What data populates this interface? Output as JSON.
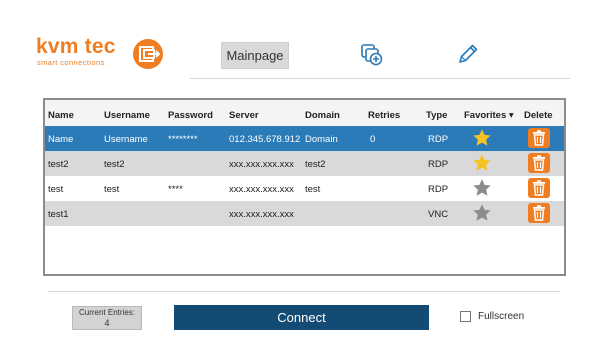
{
  "brand": {
    "name": "kvm tec",
    "tagline": "smart connections",
    "color": "#ef7d22"
  },
  "header": {
    "mainpage_label": "Mainpage",
    "icons": [
      "add-connection-icon",
      "edit-pencil-icon"
    ]
  },
  "table": {
    "columns": [
      "Name",
      "Username",
      "Password",
      "Server",
      "Domain",
      "Retries",
      "Type",
      "Favorites ▾",
      "Delete"
    ],
    "rows": [
      {
        "name": "Name",
        "username": "Username",
        "password": "********",
        "server": "012.345.678.912",
        "domain": "Domain",
        "retries": "0",
        "type": "RDP",
        "favorite": true,
        "state": "selected"
      },
      {
        "name": "test2",
        "username": "test2",
        "password": "",
        "server": "xxx.xxx.xxx.xxx",
        "domain": "test2",
        "retries": "",
        "type": "RDP",
        "favorite": true,
        "state": "gray"
      },
      {
        "name": "test",
        "username": "test",
        "password": "****",
        "server": "xxx.xxx.xxx.xxx",
        "domain": "test",
        "retries": "",
        "type": "RDP",
        "favorite": false,
        "state": "white"
      },
      {
        "name": "test1",
        "username": "",
        "password": "",
        "server": "xxx.xxx.xxx.xxx",
        "domain": "",
        "retries": "",
        "type": "VNC",
        "favorite": false,
        "state": "gray"
      }
    ]
  },
  "footer": {
    "entries_label": "Current Entries:",
    "entries_count": "4",
    "connect_label": "Connect",
    "fullscreen_label": "Fullscreen",
    "fullscreen_checked": false
  },
  "colors": {
    "selected_row": "#2a7bb8",
    "gray_row": "#d9d9d9",
    "connect_bg": "#134b75",
    "star_on": "#f6c223",
    "star_off": "#8c8c8c",
    "delete_bg": "#ef7d22"
  }
}
